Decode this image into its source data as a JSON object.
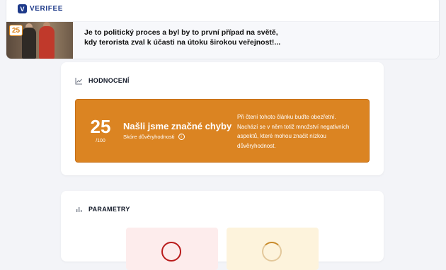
{
  "brand": {
    "logo_letter": "V",
    "name": "VERIFEE"
  },
  "article": {
    "score": "25",
    "headline_line1": "Je to politický proces a byl by to první případ na světě,",
    "headline_line2": "kdy terorista zval k účasti na útoku širokou veřejnost!..."
  },
  "evaluation": {
    "section_title": "HODNOCENÍ",
    "score": "25",
    "max": "/100",
    "verdict": "Našli jsme značné chyby",
    "score_label": "Skóre důvěryhodnosti",
    "info_glyph": "i",
    "warning": "Při čtení tohoto článku buďte obezřetní. Nachází se v něm totiž množství negativních aspektů, které mohou značit nízkou důvěryhodnost.",
    "color": "#db8422"
  },
  "parameters": {
    "section_title": "PARAMETRY"
  },
  "icons": [
    "line-chart-icon",
    "bar-chart-icon",
    "info-icon"
  ]
}
